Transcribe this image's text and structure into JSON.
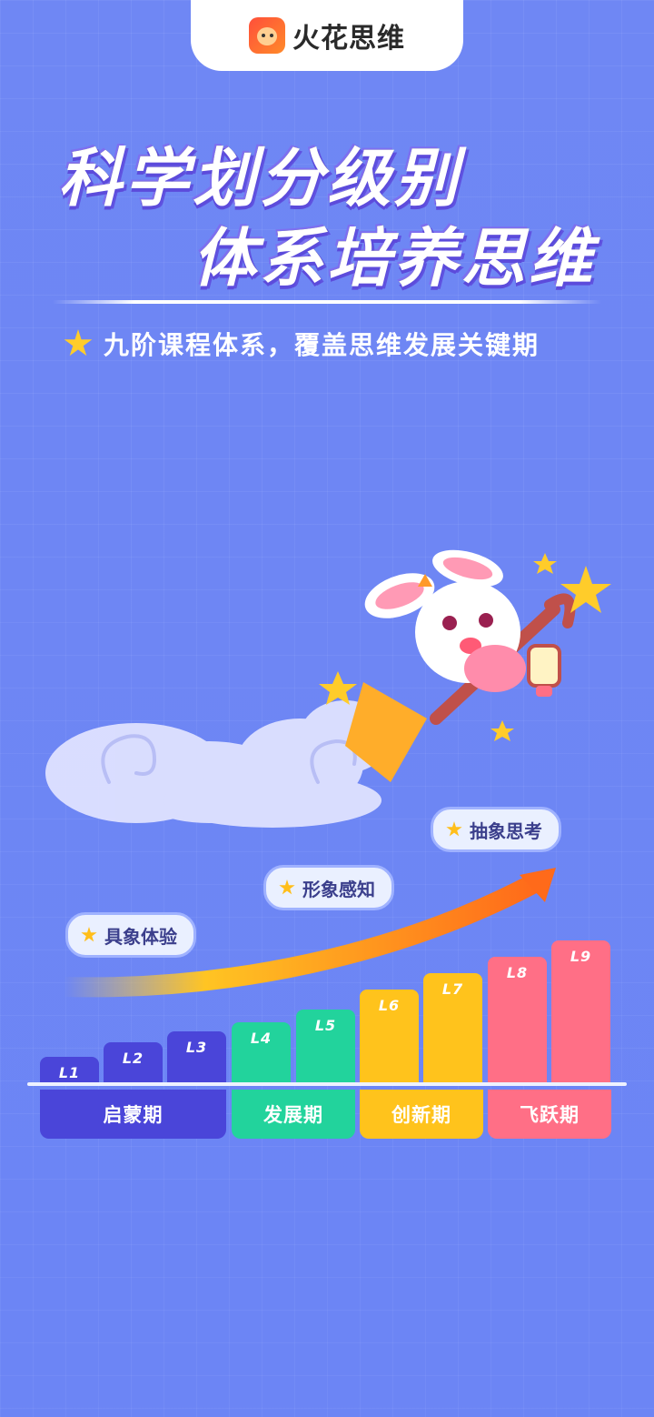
{
  "brand": {
    "name": "火花思维"
  },
  "headline": {
    "line1": "科学划分级别",
    "line2": "体系培养思维"
  },
  "subtitle": "九阶课程体系，覆盖思维发展关键期",
  "milestones": [
    "具象体验",
    "形象感知",
    "抽象思考"
  ],
  "levels": [
    {
      "label": "L1",
      "stage": "启蒙期"
    },
    {
      "label": "L2",
      "stage": "启蒙期"
    },
    {
      "label": "L3",
      "stage": "启蒙期"
    },
    {
      "label": "L4",
      "stage": "发展期"
    },
    {
      "label": "L5",
      "stage": "发展期"
    },
    {
      "label": "L6",
      "stage": "创新期"
    },
    {
      "label": "L7",
      "stage": "创新期"
    },
    {
      "label": "L8",
      "stage": "飞跃期"
    },
    {
      "label": "L9",
      "stage": "飞跃期"
    }
  ],
  "stages": [
    {
      "label": "启蒙期",
      "color": "#4a45d9"
    },
    {
      "label": "发展期",
      "color": "#22d39c"
    },
    {
      "label": "创新期",
      "color": "#ffc31c"
    },
    {
      "label": "飞跃期",
      "color": "#ff6f86"
    }
  ],
  "colors": {
    "background": "#6f88f5",
    "accent_arrow": "#ff7a1a"
  }
}
